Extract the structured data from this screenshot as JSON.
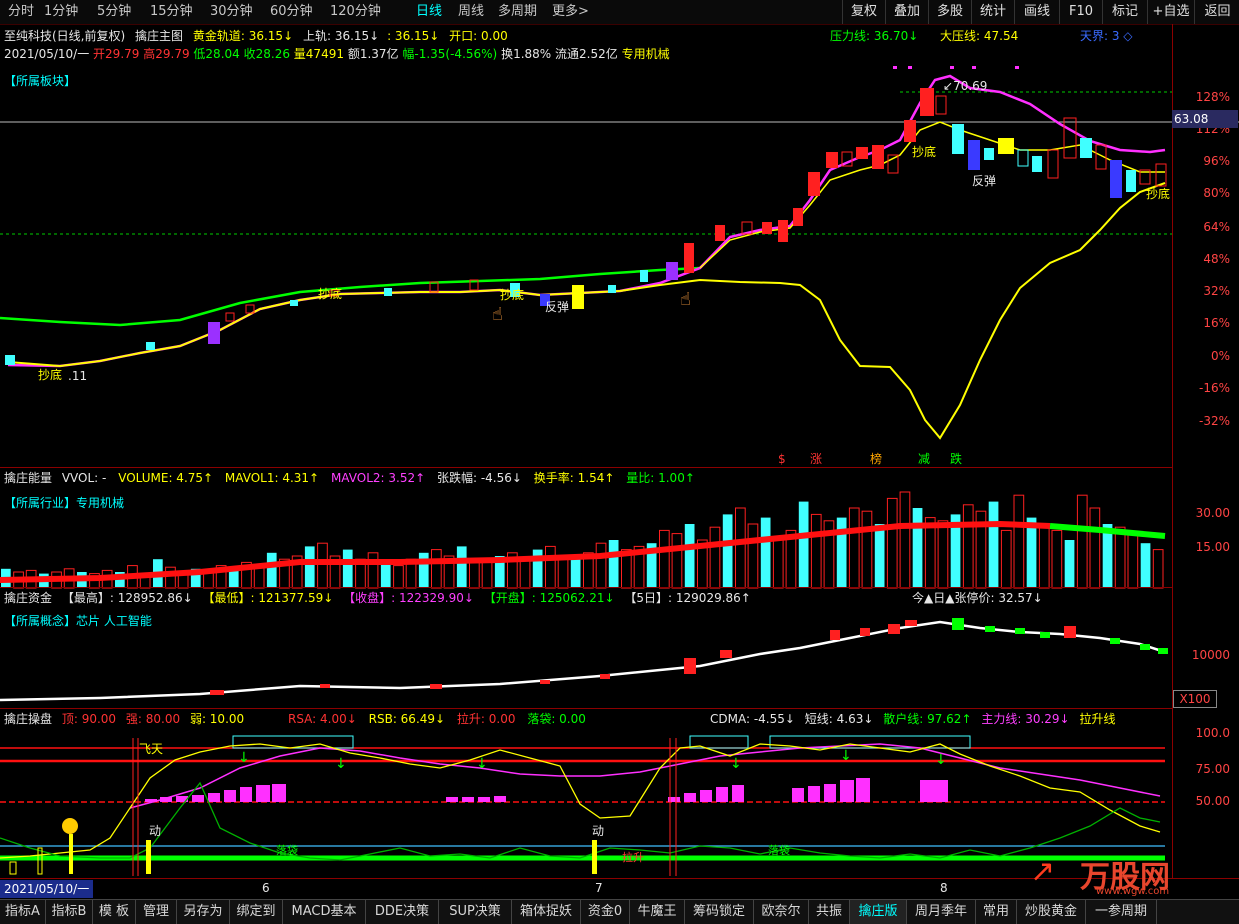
{
  "toolbar": {
    "periods": [
      "分时",
      "1分钟",
      "5分钟",
      "15分钟",
      "30分钟",
      "60分钟",
      "120分钟",
      "日线",
      "周线",
      "多周期",
      "更多>"
    ],
    "active_period": "日线",
    "right_buttons": [
      "复权",
      "叠加",
      "多股",
      "统计",
      "画线",
      "F10",
      "标记",
      "+自选",
      "返回"
    ]
  },
  "header": {
    "stock_title": "至纯科技(日线,前复权)",
    "main_indicator": "擒庄主图",
    "gold_track": "黄金轨道: 36.15↓",
    "upper_track": "上轨: 36.15↓",
    "mid_value": ": 36.15↓",
    "open_label": "开口: 0.00",
    "pressure": "压力线: 36.70↓",
    "big_pressure": "大压线: 47.54",
    "tianjie": "天界: 3 ◇"
  },
  "quote": {
    "date": "2021/05/10/一",
    "open": "开29.79",
    "high": "高29.79",
    "low": "低28.04",
    "close": "收28.26",
    "volume": "量47491",
    "amount": "额1.37亿",
    "change": "幅-1.35(-4.56%)",
    "turnover": "换1.88%",
    "float": "流通2.52亿",
    "industry": "专用机械"
  },
  "main_panel": {
    "sector_tag": "【所属板块】",
    "price_high_label": "70.69",
    "price_low_label": ".11",
    "current_price": "63.08",
    "signal_labels": [
      "抄底",
      "抄底",
      "反弹",
      "抄底",
      "抄底",
      "反弹",
      "抄底"
    ],
    "event_labels": [
      "$",
      "涨",
      "榜",
      "减",
      "跌"
    ],
    "axis_ticks": [
      "128%",
      "112%",
      "96%",
      "80%",
      "64%",
      "48%",
      "32%",
      "16%",
      "0%",
      "-16%",
      "-32%"
    ]
  },
  "volume_panel": {
    "title": "擒庄能量",
    "vol": "VVOL: -",
    "volume": "VOLUME: 4.75↑",
    "mavol1": "MAVOL1: 4.31↑",
    "mavol2": "MAVOL2: 3.52↑",
    "change": "张跌幅: -4.56↓",
    "turnover": "换手率: 1.54↑",
    "ratio": "量比: 1.00↑",
    "industry_tag": "【所属行业】专用机械",
    "axis_ticks": [
      "30.00",
      "15.00"
    ]
  },
  "fund_panel": {
    "title": "擒庄资金",
    "highest": "【最高】: 128952.86↓",
    "lowest": "【最低】: 121377.59↓",
    "close": "【收盘】: 122329.90↓",
    "open": "【开盘】: 125062.21↓",
    "five_day": "【5日】: 129029.86↑",
    "limit_price": "今▲日▲张停价: 32.57↓",
    "concept_tag": "【所属概念】芯片 人工智能",
    "axis_ticks": [
      "10000"
    ],
    "unit": "X100"
  },
  "operate_panel": {
    "title": "擒庄操盘",
    "top": "顶: 90.00",
    "strong": "强: 80.00",
    "weak": "弱: 10.00",
    "rsa": "RSA: 4.00↓",
    "rsb": "RSB: 66.49↓",
    "lift": "拉升: 0.00",
    "fall": "落袋: 0.00",
    "cdma": "CDMA: -4.55↓",
    "short": "短线: 4.63↓",
    "retail": "散户线: 97.62↑",
    "main": "主力线: 30.29↓",
    "pull": "拉升线",
    "labels": [
      "飞天",
      "动",
      "动",
      "落袋",
      "落袋",
      "拉升"
    ],
    "axis_ticks": [
      "100.0",
      "75.00",
      "50.00"
    ]
  },
  "time_axis": {
    "cursor_date": "2021/05/10/一",
    "months": [
      "6",
      "7",
      "8"
    ]
  },
  "bottom_tabs": [
    "指标A",
    "指标B",
    "模 板",
    "管理",
    "另存为",
    "绑定到",
    "MACD基本",
    "DDE决策",
    "SUP决策",
    "箱体捉妖",
    "资金0",
    "牛魔王",
    "筹码锁定",
    "欧奈尔",
    "共振",
    "擒庄版",
    "周月季年",
    "常用",
    "炒股黄金",
    "一参周期"
  ],
  "active_bottom_tab": "擒庄版",
  "watermark": {
    "brand": "万股网",
    "url": "www.wgw.com"
  },
  "colors": {
    "up": "#ff2020",
    "down": "#40ffff",
    "green": "#00ff00",
    "yellow": "#ffff00",
    "magenta": "#ff30ff",
    "grid": "#8b0000"
  }
}
